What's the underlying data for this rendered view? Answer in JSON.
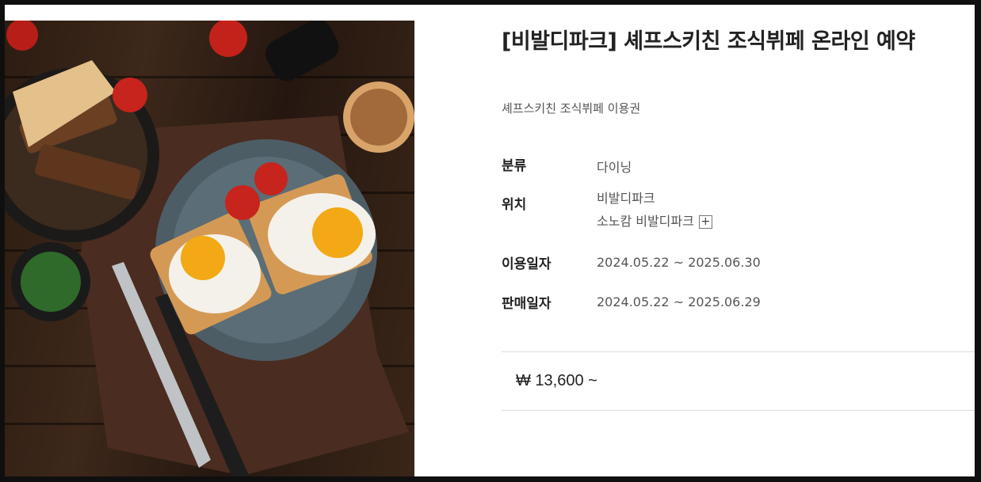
{
  "product": {
    "title": "[비발디파크] 셰프스키친 조식뷔페 온라인 예약",
    "subtitle": "셰프스키친 조식뷔페 이용권",
    "image_icon": "breakfast-photo"
  },
  "details": {
    "category": {
      "label": "분류",
      "value": "다이닝"
    },
    "location": {
      "label": "위치",
      "line1": "비발디파크",
      "line2": "소노캄 비발디파크",
      "expand_icon": "plus-icon",
      "expand_glyph": "+"
    },
    "use_period": {
      "label": "이용일자",
      "value": "2024.05.22 ~ 2025.06.30"
    },
    "sale_period": {
      "label": "판매일자",
      "value": "2024.05.22 ~ 2025.06.29"
    }
  },
  "price": {
    "text": "₩ 13,600 ~"
  }
}
